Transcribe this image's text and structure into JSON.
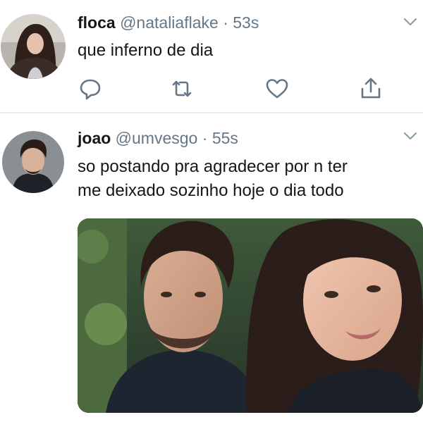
{
  "tweets": [
    {
      "name": "floca",
      "handle": "@nataliaflake",
      "separator": "·",
      "time": "53s",
      "text_lines": [
        "que inferno de dia"
      ]
    },
    {
      "name": "joao",
      "handle": "@umvesgo",
      "separator": "·",
      "time": "55s",
      "text_lines": [
        "so postando pra agradecer por n ter",
        "me deixado sozinho hoje o dia todo"
      ]
    }
  ],
  "icons": {
    "reply": "reply-icon",
    "retweet": "retweet-icon",
    "like": "heart-icon",
    "share": "share-icon",
    "menu": "chevron-down-icon"
  },
  "colors": {
    "icon": "#657786",
    "muted_text": "#657786",
    "divider": "#e6ecf0"
  }
}
